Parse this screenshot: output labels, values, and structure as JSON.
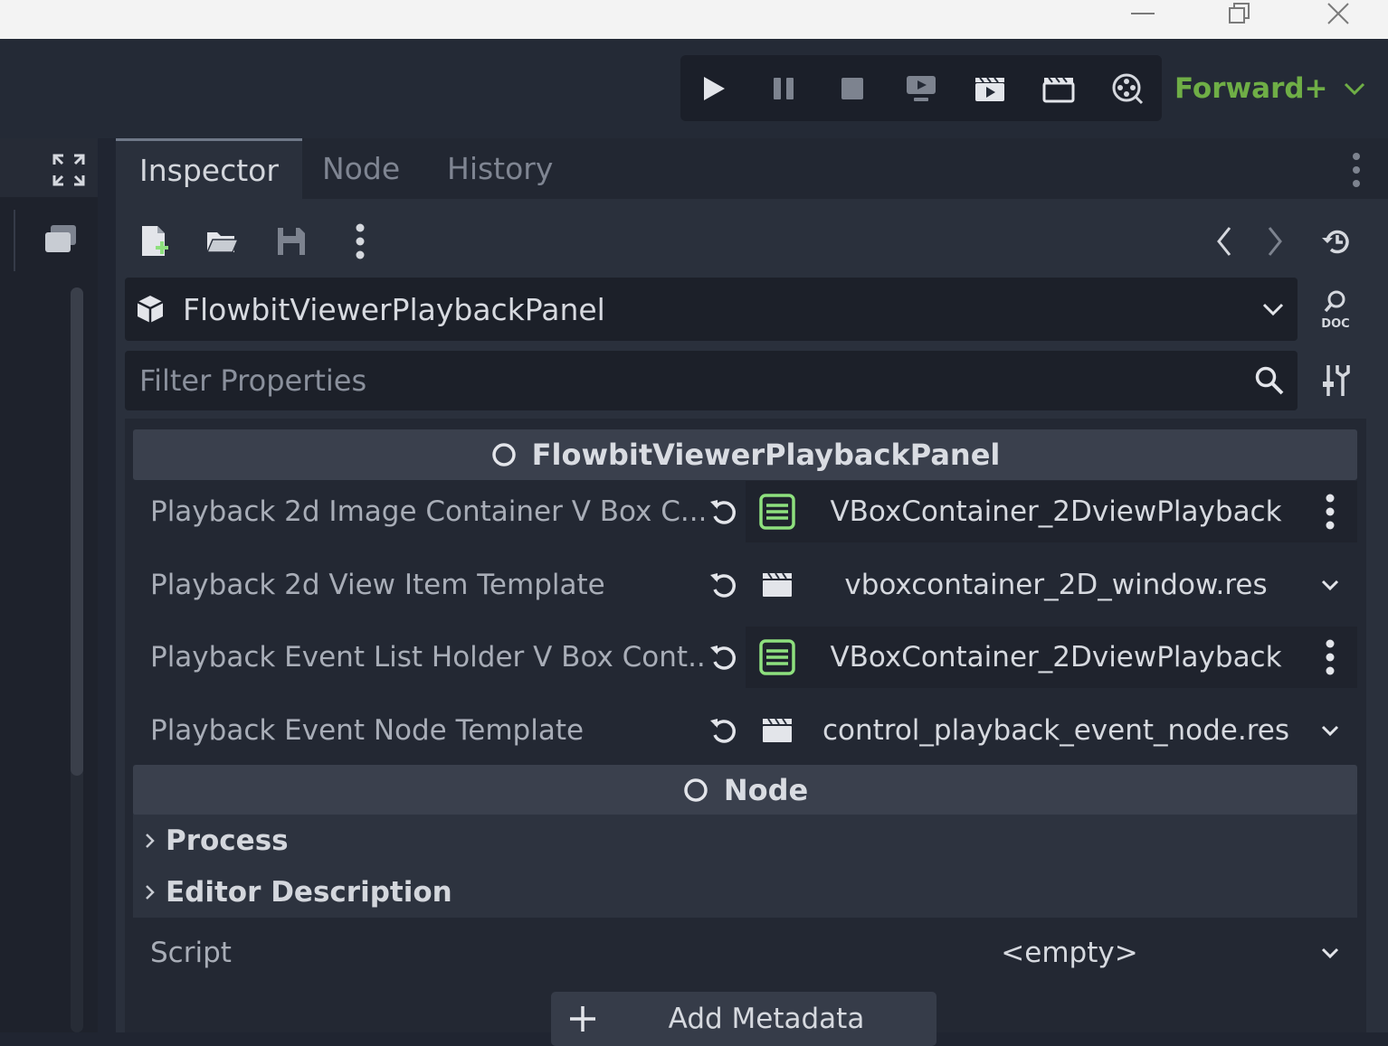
{
  "toolbar": {
    "renderer": "Forward+"
  },
  "tabs": [
    {
      "label": "Inspector",
      "active": true
    },
    {
      "label": "Node",
      "active": false
    },
    {
      "label": "History",
      "active": false
    }
  ],
  "inspector": {
    "object_name": "FlowbitViewerPlaybackPanel",
    "filter_placeholder": "Filter Properties",
    "sections": {
      "script_class": "FlowbitViewerPlaybackPanel",
      "node": "Node"
    },
    "properties": [
      {
        "label": "Playback 2d Image Container V Box C...",
        "value": "VBoxContainer_2DviewPlayback",
        "icon": "vbox-container-icon",
        "end": "kebab-menu-icon"
      },
      {
        "label": "Playback 2d View Item Template",
        "value": "vboxcontainer_2D_window.res",
        "icon": "packed-scene-icon",
        "end": "chevron-down-icon"
      },
      {
        "label": "Playback Event List Holder V Box Cont...",
        "value": "VBoxContainer_2DviewPlayback",
        "icon": "vbox-container-icon",
        "end": "kebab-menu-icon"
      },
      {
        "label": "Playback Event Node Template",
        "value": "control_playback_event_node.res",
        "icon": "packed-scene-icon",
        "end": "chevron-down-icon"
      }
    ],
    "groups": [
      {
        "label": "Process"
      },
      {
        "label": "Editor Description"
      }
    ],
    "script": {
      "label": "Script",
      "value": "<empty>"
    },
    "add_metadata": "Add Metadata"
  },
  "colors": {
    "accent_green": "#6fae46",
    "vbox_green": "#8ee07e",
    "panel_bg": "#2a303c",
    "section_bg": "#3a404d"
  }
}
